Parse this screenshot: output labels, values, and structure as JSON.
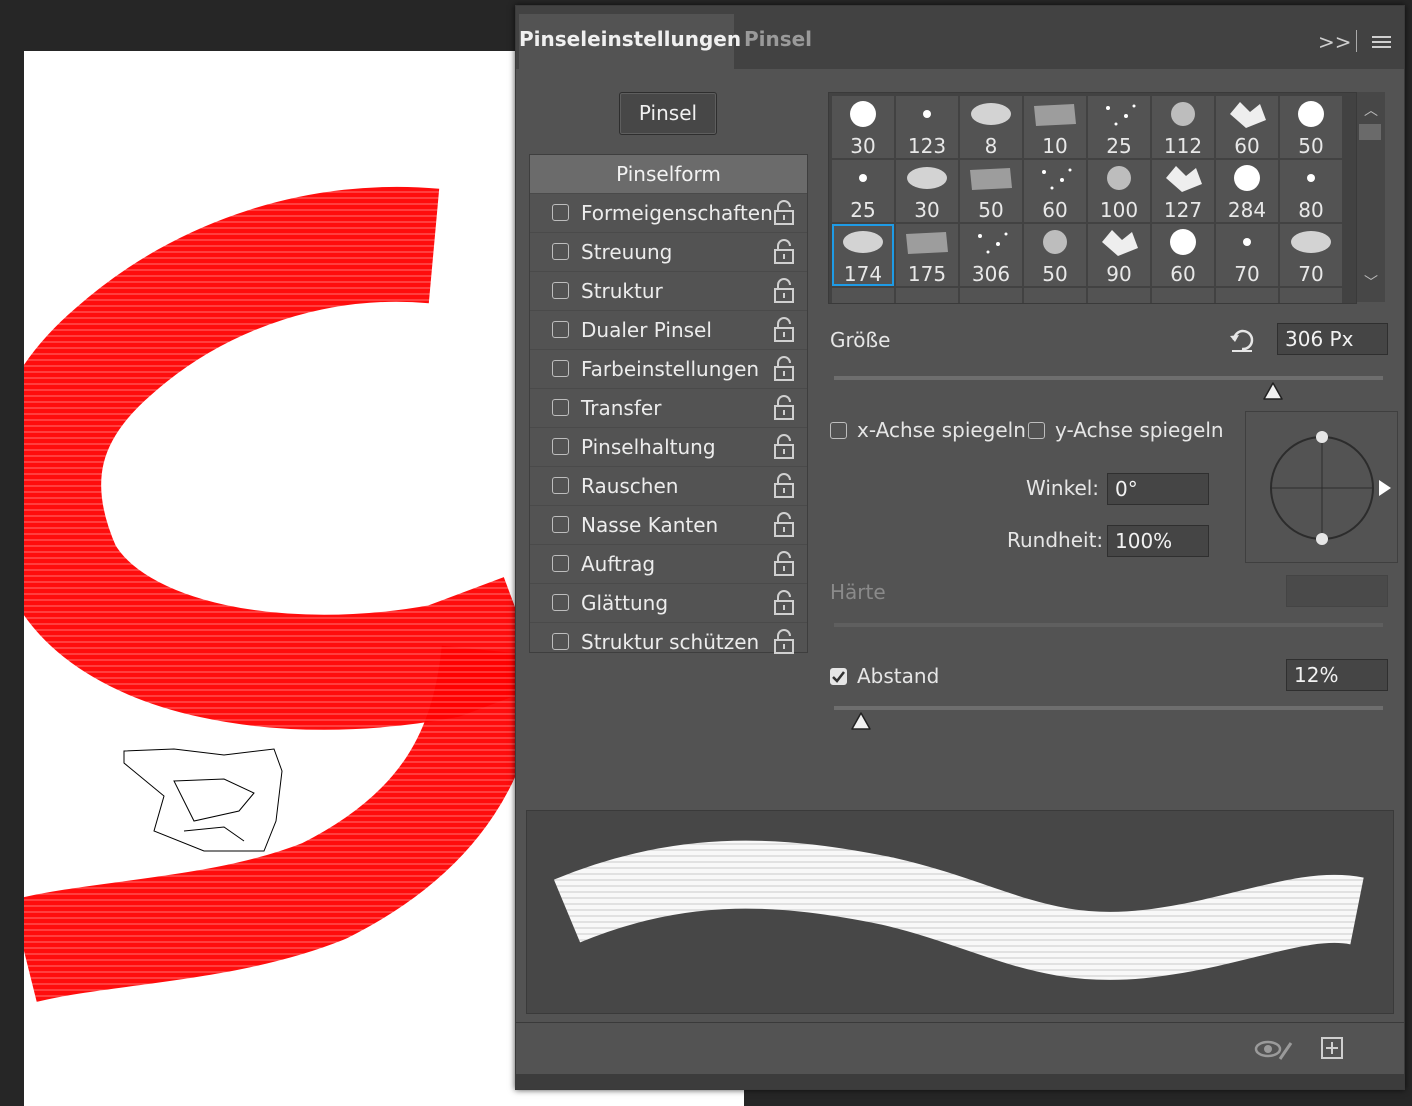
{
  "tabs": [
    {
      "label": "Pinseleinstellungen",
      "active": true
    },
    {
      "label": "Pinsel",
      "active": false
    }
  ],
  "tab_controls": {
    "collapse": ">>"
  },
  "brush_button": "Pinsel",
  "options_header": "Pinselform",
  "options": [
    "Formeigenschaften",
    "Streuung",
    "Struktur",
    "Dualer Pinsel",
    "Farbeinstellungen",
    "Transfer",
    "Pinselhaltung",
    "Rauschen",
    "Nasse Kanten",
    "Auftrag",
    "Glättung",
    "Struktur schützen"
  ],
  "presets": [
    [
      "30",
      "123",
      "8",
      "10",
      "25",
      "112",
      "60",
      "50"
    ],
    [
      "25",
      "30",
      "50",
      "60",
      "100",
      "127",
      "284",
      "80"
    ],
    [
      "174",
      "175",
      "306",
      "50",
      "90",
      "60",
      "70",
      "70"
    ]
  ],
  "selected_preset": "174",
  "size": {
    "label": "Größe",
    "value": "306 Px",
    "slider_fraction": 0.8
  },
  "flip_x": {
    "label": "x-Achse spiegeln",
    "checked": false
  },
  "flip_y": {
    "label": "y-Achse spiegeln",
    "checked": false
  },
  "angle": {
    "label": "Winkel:",
    "value": "0°"
  },
  "roundness": {
    "label": "Rundheit:",
    "value": "100%"
  },
  "hardness": {
    "label": "Härte",
    "value": ""
  },
  "spacing": {
    "label": "Abstand",
    "value": "12%",
    "checked": true,
    "slider_fraction": 0.05
  },
  "colors": {
    "panel": "#535353",
    "stroke": "#ff0000",
    "selection": "#1e9be6"
  }
}
